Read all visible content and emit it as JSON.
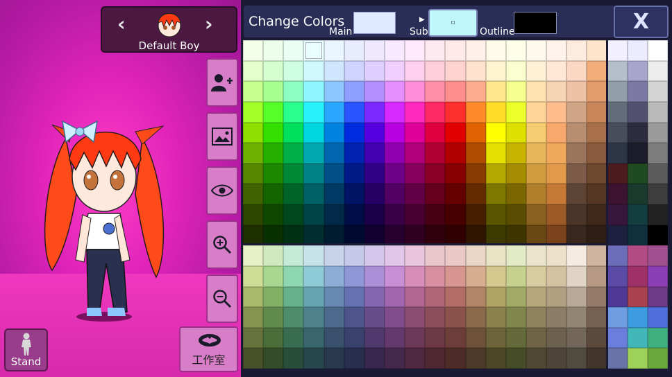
{
  "character": {
    "name": "Default Boy",
    "prev_icon": "chevron-left-icon",
    "next_icon": "chevron-right-icon"
  },
  "side_buttons": [
    {
      "name": "add-character-button",
      "icon": "add-user-icon"
    },
    {
      "name": "background-button",
      "icon": "image-icon"
    },
    {
      "name": "visibility-button",
      "icon": "eye-icon"
    },
    {
      "name": "zoom-in-button",
      "icon": "zoom-in-icon"
    },
    {
      "name": "zoom-out-button",
      "icon": "zoom-out-icon"
    }
  ],
  "studio": {
    "label": "工作室",
    "icon": "bat-icon"
  },
  "stand": {
    "label": "Stand",
    "icon": "person-icon"
  },
  "panel": {
    "title": "Change Colors",
    "main_label": "Main",
    "sub_label": "Sub",
    "outline_label": "Outline",
    "main_color": "#dfe9ff",
    "sub_color": "#bff7fb",
    "outline_color": "#000000",
    "close_label": "X"
  },
  "palette": {
    "rows": [
      [
        "#f4ffe9",
        "#ecffea",
        "#e9fff3",
        "#e9ffff",
        "#e9f5ff",
        "#e9ecff",
        "#efe9ff",
        "#f7e9ff",
        "#ffe9fb",
        "#ffe9f1",
        "#ffe9e9",
        "#fff0e9",
        "#fffbe9",
        "#fdffe9",
        "#fff9ec",
        "#fff3ec",
        "#fdebe0",
        "#ffe4cc",
        "#f2f0ff",
        "#ecebff",
        "#ffffff"
      ],
      [
        "#e3ffcc",
        "#d6ffcf",
        "#cfffe3",
        "#cff9ff",
        "#cfe6ff",
        "#cfd4ff",
        "#ddcfff",
        "#f0cfff",
        "#ffcfee",
        "#ffcfdb",
        "#ffd3cf",
        "#ffe3cf",
        "#fff4cf",
        "#fbffcf",
        "#fff1d6",
        "#ffe8d6",
        "#fbd8c4",
        "#f3ad7a",
        "#b5bfcc",
        "#a8a5cc",
        "#ececec"
      ],
      [
        "#c9ff8e",
        "#a6ff8e",
        "#8effc2",
        "#8ef6ff",
        "#8ec7ff",
        "#8e9fff",
        "#b28eff",
        "#e48eff",
        "#ff8ed8",
        "#ff8ea9",
        "#ff8e8e",
        "#ffac8e",
        "#ffe78e",
        "#f5ff8e",
        "#ffe2b0",
        "#f5d4b4",
        "#efc1a5",
        "#e39d6d",
        "#929eaa",
        "#7c7aa5",
        "#d4d4d4"
      ],
      [
        "#a3ff29",
        "#56ff29",
        "#29ff8d",
        "#29f2ff",
        "#29a7ff",
        "#2954ff",
        "#7b29ff",
        "#d629ff",
        "#ff29bd",
        "#ff2967",
        "#ff2f2f",
        "#ff8a2a",
        "#ffde29",
        "#ecff29",
        "#ffd697",
        "#ffbd8d",
        "#cfa585",
        "#c9865a",
        "#626c7a",
        "#525170",
        "#bababa"
      ],
      [
        "#8ee000",
        "#33e000",
        "#00e05c",
        "#00d6e0",
        "#0083e0",
        "#002ce0",
        "#5600e0",
        "#b800e0",
        "#e0009a",
        "#e00042",
        "#e00000",
        "#e06200",
        "#ffff00",
        "#dde000",
        "#f5cd70",
        "#f8a86c",
        "#b88e70",
        "#a7704a",
        "#474e5a",
        "#2d2c3f",
        "#9a9a9a"
      ],
      [
        "#6fb000",
        "#25b000",
        "#00b046",
        "#00a9b0",
        "#0066b0",
        "#0022b0",
        "#4300b0",
        "#9000b0",
        "#b00079",
        "#b00033",
        "#b00000",
        "#b04c00",
        "#e4e000",
        "#c7b300",
        "#e6b658",
        "#f0a85c",
        "#9b745c",
        "#8a5a3c",
        "#2d3646",
        "#1c1c2a",
        "#7c7c7c"
      ],
      [
        "#568800",
        "#1c8800",
        "#008836",
        "#008288",
        "#004f88",
        "#001a88",
        "#330088",
        "#6f0088",
        "#88005d",
        "#880027",
        "#880000",
        "#883b00",
        "#b2aa00",
        "#a68c00",
        "#d09c3e",
        "#e29a4a",
        "#7c5a48",
        "#6e472f",
        "#4c1c1e",
        "#1f4a22",
        "#5c5c5c"
      ],
      [
        "#3f6400",
        "#146400",
        "#006428",
        "#006064",
        "#003a64",
        "#001364",
        "#260064",
        "#520064",
        "#640045",
        "#64001d",
        "#640000",
        "#642b00",
        "#7e7800",
        "#7a6700",
        "#b07f2b",
        "#c57935",
        "#5e4435",
        "#543623",
        "#3c1430",
        "#1a3a2e",
        "#3e3e3e"
      ],
      [
        "#2d4700",
        "#0e4700",
        "#00471c",
        "#004447",
        "#002a47",
        "#000e47",
        "#1b0047",
        "#3a0047",
        "#470031",
        "#470015",
        "#470000",
        "#471f00",
        "#5a5600",
        "#5a4c00",
        "#8a601e",
        "#9b5a26",
        "#4a3528",
        "#3f281a",
        "#38163e",
        "#123e3f",
        "#222222"
      ],
      [
        "#1e3000",
        "#093000",
        "#003013",
        "#002e30",
        "#001c30",
        "#000930",
        "#120030",
        "#270030",
        "#300021",
        "#30000e",
        "#300000",
        "#301500",
        "#3d3a00",
        "#3f3500",
        "#6a4815",
        "#7a431b",
        "#3a281e",
        "#2f1e13",
        "#1e2040",
        "#10303c",
        "#000000"
      ],
      [
        "#e7f0c6",
        "#cfeabf",
        "#c6ead8",
        "#c6e3ea",
        "#c6d3ea",
        "#c6c9ea",
        "#d2c6ea",
        "#e2c6ea",
        "#eac6dc",
        "#eac6cd",
        "#eac9c6",
        "#ead5c6",
        "#eae4c6",
        "#e3eac6",
        "#ebe4cc",
        "#ede0c9",
        "#f5ebe3",
        "#cfb4a0",
        "#6b6db9",
        "#b34c84",
        "#a0508f"
      ],
      [
        "#d0dd96",
        "#a9d78f",
        "#8fd7b0",
        "#8fcbd7",
        "#8faed7",
        "#8f97d7",
        "#ab8fd7",
        "#c88fd7",
        "#d78fb9",
        "#d78fa1",
        "#d7968f",
        "#d7ae8f",
        "#d7c88f",
        "#c6d18f",
        "#d8cca0",
        "#d5c2a2",
        "#e0d4c4",
        "#b79a85",
        "#5b4ba7",
        "#9e3167",
        "#8c3fb4"
      ],
      [
        "#a9b96c",
        "#82b166",
        "#66b18b",
        "#66a5b1",
        "#6688b1",
        "#6671b1",
        "#8666b1",
        "#a266b1",
        "#b16692",
        "#b1667a",
        "#b16d66",
        "#b18666",
        "#b1a266",
        "#a1aa66",
        "#b6a67a",
        "#b19f82",
        "#baa896",
        "#957a68",
        "#4e3a96",
        "#a8434f",
        "#6c3a86"
      ],
      [
        "#869451",
        "#628c4d",
        "#4d8c6c",
        "#4d828c",
        "#4d698c",
        "#4d558c",
        "#684d8c",
        "#824d8c",
        "#8c4d73",
        "#8c4d5d",
        "#8c534d",
        "#8c6a4d",
        "#8c824d",
        "#81884d",
        "#8f825c",
        "#8c7e66",
        "#928573",
        "#76604f",
        "#6f9de2",
        "#3d9be0",
        "#4e6fdc"
      ],
      [
        "#67733c",
        "#4a6d39",
        "#396d52",
        "#39656d",
        "#39516d",
        "#39416d",
        "#50396d",
        "#64396d",
        "#6d3959",
        "#6d3947",
        "#6d3e39",
        "#6d5139",
        "#6d6539",
        "#646a39",
        "#6f6546",
        "#6c614e",
        "#726758",
        "#5c4a3c",
        "#6b7edc",
        "#41b7b9",
        "#3fb07f"
      ],
      [
        "#48522a",
        "#344d28",
        "#284d3a",
        "#28474d",
        "#28394d",
        "#282e4d",
        "#38284d",
        "#46284d",
        "#4d283f",
        "#4d2832",
        "#4d2c28",
        "#4d3928",
        "#4d4728",
        "#464b28",
        "#504832",
        "#4d4537",
        "#514a3e",
        "#42352a",
        "#6874a8",
        "#9ed159",
        "#6aa83c"
      ]
    ],
    "selected": "#e9ffff"
  }
}
